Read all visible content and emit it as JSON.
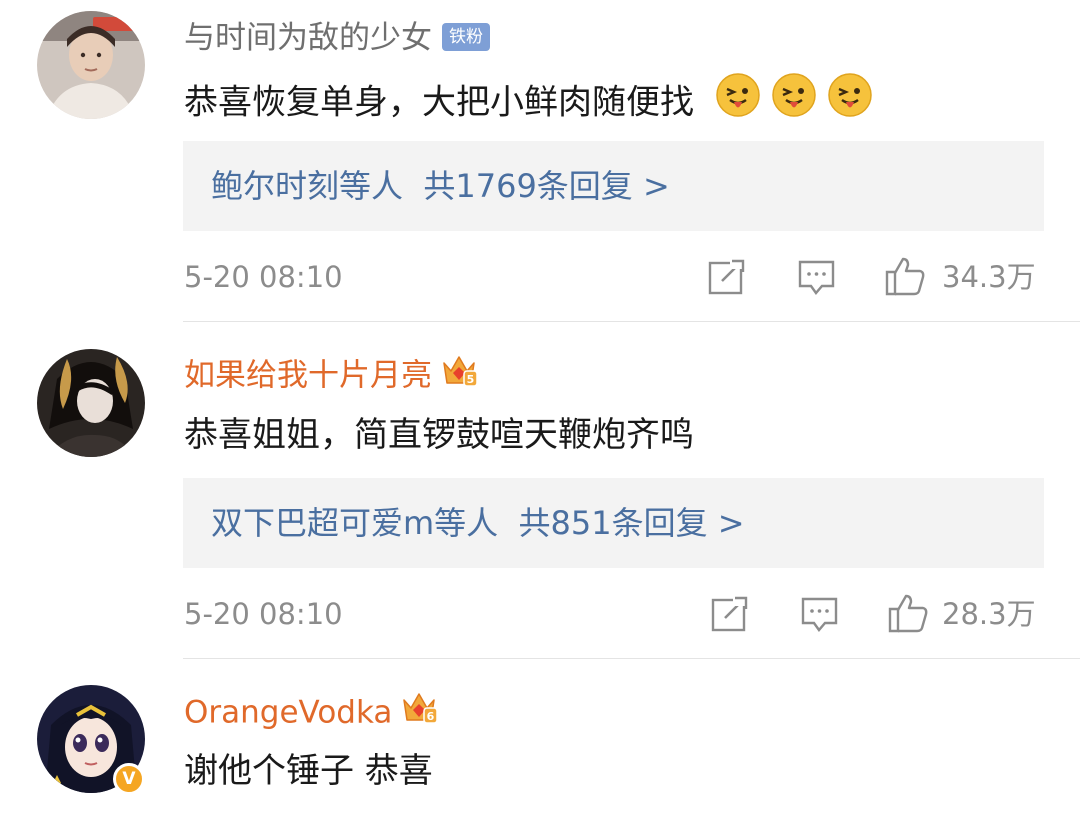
{
  "comments": [
    {
      "username": "与时间为敌的少女",
      "badge": "铁粉",
      "text": "恭喜恢复单身，大把小鲜肉随便找",
      "reply_names": "鲍尔时刻等人",
      "reply_count": "共1769条回复 >",
      "time": "5-20 08:10",
      "likes": "34.3万",
      "emoji_name": "tongue-out-emoji",
      "emoji_count": 3
    },
    {
      "username": "如果给我十片月亮",
      "crown_level": "5",
      "text": "恭喜姐姐，简直锣鼓喧天鞭炮齐鸣",
      "reply_names": "双下巴超可爱m等人",
      "reply_count": "共851条回复 >",
      "time": "5-20 08:10",
      "likes": "28.3万"
    },
    {
      "username": "OrangeVodka",
      "crown_level": "6",
      "verified": "V",
      "text": "谢他个锤子 恭喜"
    }
  ],
  "icons": {
    "share": "share-icon",
    "comment": "comment-icon",
    "like": "thumbs-up-icon",
    "crown": "vip-crown-icon"
  },
  "colors": {
    "username_plain": "#6f6f6f",
    "username_vip": "#e0692a",
    "reply_link": "#4a6fa0",
    "fan_badge": "#7e9fd6",
    "meta": "#8c8c8c"
  }
}
